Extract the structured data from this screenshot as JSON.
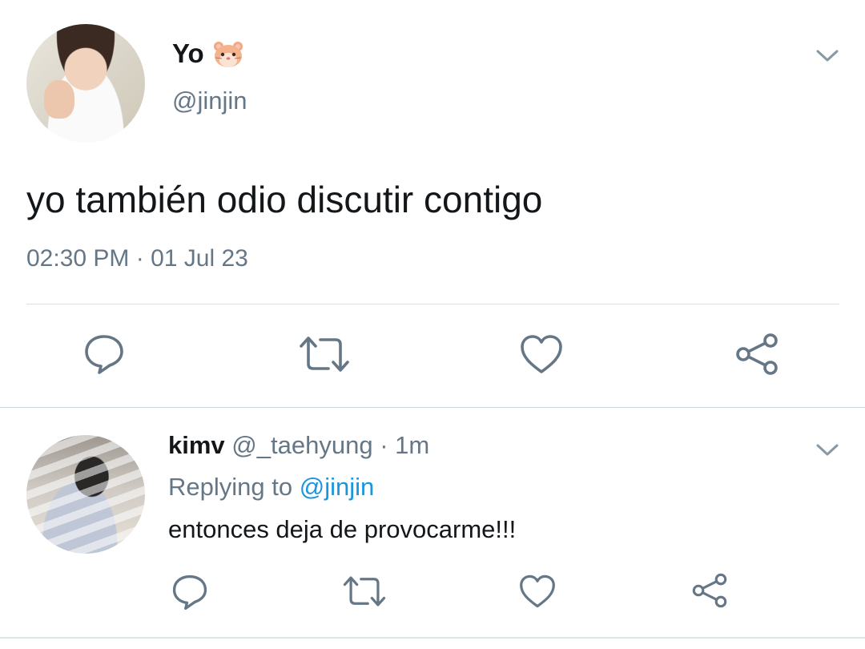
{
  "colors": {
    "text": "#14171a",
    "muted": "#657786",
    "link": "#1b95e0",
    "divider": "#d8dee2"
  },
  "tweet": {
    "display_name": "Yo",
    "name_emoji": "hamster-face-icon",
    "handle": "@jinjin",
    "text": "yo también odio discutir contigo",
    "time": "02:30 PM",
    "separator": " · ",
    "date": "01 Jul 23",
    "actions": [
      "reply-icon",
      "retweet-icon",
      "like-icon",
      "share-icon"
    ]
  },
  "reply": {
    "display_name": "kimv",
    "handle": "@_taehyung",
    "separator": " · ",
    "age": "1m",
    "replying_prefix": "Replying to ",
    "replying_mention": "@jinjin",
    "text": "entonces deja de provocarme!!!",
    "actions": [
      "reply-icon",
      "retweet-icon",
      "like-icon",
      "share-icon"
    ]
  }
}
